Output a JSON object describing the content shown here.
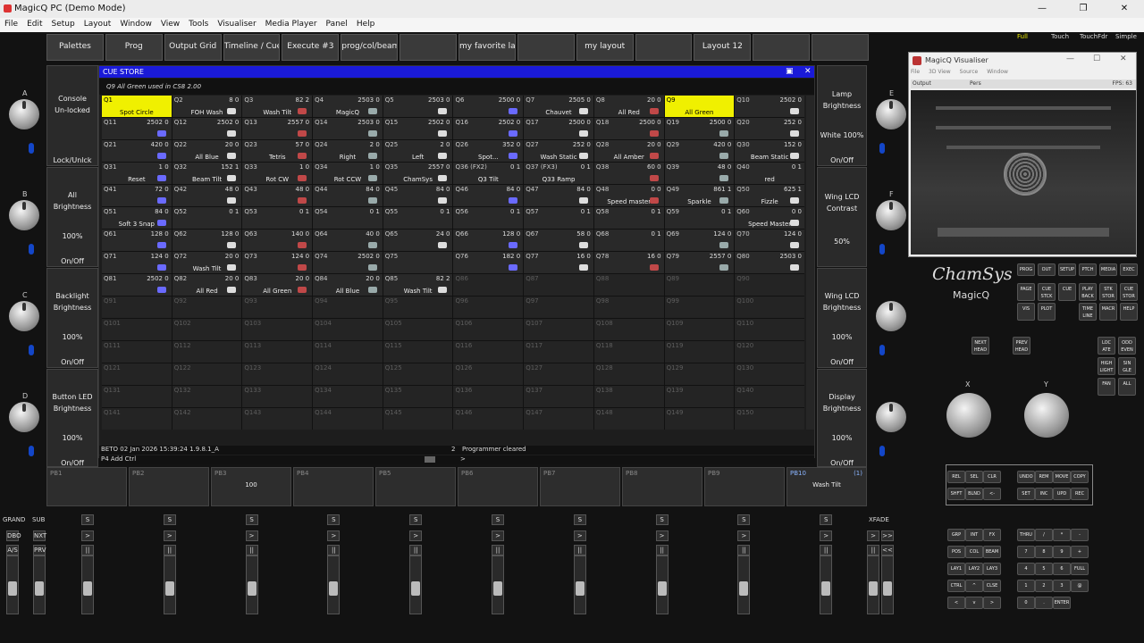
{
  "window": {
    "title": "MagicQ PC (Demo Mode)",
    "controls": [
      "—",
      "❐",
      "✕"
    ]
  },
  "menu": [
    "File",
    "Edit",
    "Setup",
    "Layout",
    "Window",
    "View",
    "Tools",
    "Visualiser",
    "Media Player",
    "Panel",
    "Help"
  ],
  "top_buttons": [
    "Palettes",
    "Prog",
    "Output Grid",
    "Timeline / Cues",
    "Execute #3",
    "prog/col/beam",
    "",
    "my favorite la",
    "",
    "my layout",
    "",
    "Layout 12",
    "",
    ""
  ],
  "left_column": [
    {
      "line1": "Console",
      "line2": "Un-locked",
      "value": "",
      "bottom": "Lock/Unlck",
      "letter": "A"
    },
    {
      "line1": "All",
      "line2": "Brightness",
      "value": "100%",
      "bottom": "On/Off",
      "letter": "B"
    },
    {
      "line1": "Backlight",
      "line2": "Brightness",
      "value": "100%",
      "bottom": "On/Off",
      "letter": "C"
    },
    {
      "line1": "Button LED",
      "line2": "Brightness",
      "value": "100%",
      "bottom": "On/Off",
      "letter": "D"
    }
  ],
  "right_column": [
    {
      "line1": "Lamp",
      "line2": "Brightness",
      "value": "White 100%",
      "bottom": "On/Off",
      "letter": "E"
    },
    {
      "line1": "Wing LCD",
      "line2": "Contrast",
      "value": "50%",
      "bottom": "",
      "letter": "F"
    },
    {
      "line1": "Wing LCD",
      "line2": "Brightness",
      "value": "100%",
      "bottom": "On/Off",
      "letter": ""
    },
    {
      "line1": "Display",
      "line2": "Brightness",
      "value": "100%",
      "bottom": "On/Off",
      "letter": ""
    }
  ],
  "cue_store": {
    "title": "CUE STORE",
    "info": "Q9 All Green used in CS8 2.00",
    "selected_index": 8,
    "cells": [
      {
        "id": "Q1",
        "num": "",
        "name": "Spot Circle"
      },
      {
        "id": "Q2",
        "num": "8 0",
        "name": "FOH Wash"
      },
      {
        "id": "Q3",
        "num": "82 2",
        "name": "Wash Tilt"
      },
      {
        "id": "Q4",
        "num": "2503 0",
        "name": "MagicQ"
      },
      {
        "id": "Q5",
        "num": "2503 0",
        "name": ""
      },
      {
        "id": "Q6",
        "num": "2500 0",
        "name": ""
      },
      {
        "id": "Q7",
        "num": "2505 0",
        "name": "Chauvet"
      },
      {
        "id": "Q8",
        "num": "20 0",
        "name": "All Red"
      },
      {
        "id": "Q9",
        "num": "",
        "name": "All Green"
      },
      {
        "id": "Q10",
        "num": "2502 0",
        "name": ""
      },
      {
        "id": "Q11",
        "num": "2502 0",
        "name": ""
      },
      {
        "id": "Q12",
        "num": "2502 0",
        "name": ""
      },
      {
        "id": "Q13",
        "num": "2557 0",
        "name": ""
      },
      {
        "id": "Q14",
        "num": "2503 0",
        "name": ""
      },
      {
        "id": "Q15",
        "num": "2502 0",
        "name": ""
      },
      {
        "id": "Q16",
        "num": "2502 0",
        "name": ""
      },
      {
        "id": "Q17",
        "num": "2500 0",
        "name": ""
      },
      {
        "id": "Q18",
        "num": "2500 0",
        "name": ""
      },
      {
        "id": "Q19",
        "num": "2500 0",
        "name": ""
      },
      {
        "id": "Q20",
        "num": "252 0",
        "name": ""
      },
      {
        "id": "Q21",
        "num": "420 0",
        "name": ""
      },
      {
        "id": "Q22",
        "num": "20 0",
        "name": "All Blue"
      },
      {
        "id": "Q23",
        "num": "57 0",
        "name": "Tetris"
      },
      {
        "id": "Q24",
        "num": "2 0",
        "name": "Right"
      },
      {
        "id": "Q25",
        "num": "2 0",
        "name": "Left"
      },
      {
        "id": "Q26",
        "num": "352 0",
        "name": "Spot..."
      },
      {
        "id": "Q27",
        "num": "252 0",
        "name": "Wash Static"
      },
      {
        "id": "Q28",
        "num": "20 0",
        "name": "All Amber"
      },
      {
        "id": "Q29",
        "num": "420 0",
        "name": ""
      },
      {
        "id": "Q30",
        "num": "152 0",
        "name": "Beam Static"
      },
      {
        "id": "Q31",
        "num": "1 0",
        "name": "Reset"
      },
      {
        "id": "Q32",
        "num": "152 1",
        "name": "Beam Tilt"
      },
      {
        "id": "Q33",
        "num": "1 0",
        "name": "Rot CW"
      },
      {
        "id": "Q34",
        "num": "1 0",
        "name": "Rot CCW"
      },
      {
        "id": "Q35",
        "num": "2557 0",
        "name": "ChamSys"
      },
      {
        "id": "Q36 (FX2)",
        "num": "0 1",
        "name": "Q3 Tilt"
      },
      {
        "id": "Q37 (FX3)",
        "num": "0 1",
        "name": "Q33 Ramp"
      },
      {
        "id": "Q38",
        "num": "60 0",
        "name": ""
      },
      {
        "id": "Q39",
        "num": "48 0",
        "name": ""
      },
      {
        "id": "Q40",
        "num": "0 1",
        "name": "red"
      },
      {
        "id": "Q41",
        "num": "72 0",
        "name": ""
      },
      {
        "id": "Q42",
        "num": "48 0",
        "name": ""
      },
      {
        "id": "Q43",
        "num": "48 0",
        "name": ""
      },
      {
        "id": "Q44",
        "num": "84 0",
        "name": ""
      },
      {
        "id": "Q45",
        "num": "84 0",
        "name": ""
      },
      {
        "id": "Q46",
        "num": "84 0",
        "name": ""
      },
      {
        "id": "Q47",
        "num": "84 0",
        "name": ""
      },
      {
        "id": "Q48",
        "num": "0 0",
        "name": "Speed master"
      },
      {
        "id": "Q49",
        "num": "861 1",
        "name": "Sparkle"
      },
      {
        "id": "Q50",
        "num": "625 1",
        "name": "Fizzle"
      },
      {
        "id": "Q51",
        "num": "84 0",
        "name": "Soft 3 Snap"
      },
      {
        "id": "Q52",
        "num": "0 1",
        "name": ""
      },
      {
        "id": "Q53",
        "num": "0 1",
        "name": ""
      },
      {
        "id": "Q54",
        "num": "0 1",
        "name": ""
      },
      {
        "id": "Q55",
        "num": "0 1",
        "name": ""
      },
      {
        "id": "Q56",
        "num": "0 1",
        "name": ""
      },
      {
        "id": "Q57",
        "num": "0 1",
        "name": ""
      },
      {
        "id": "Q58",
        "num": "0 1",
        "name": ""
      },
      {
        "id": "Q59",
        "num": "0 1",
        "name": ""
      },
      {
        "id": "Q60",
        "num": "0 0",
        "name": "Speed Master"
      },
      {
        "id": "Q61",
        "num": "128 0",
        "name": ""
      },
      {
        "id": "Q62",
        "num": "128 0",
        "name": ""
      },
      {
        "id": "Q63",
        "num": "140 0",
        "name": ""
      },
      {
        "id": "Q64",
        "num": "40 0",
        "name": ""
      },
      {
        "id": "Q65",
        "num": "24 0",
        "name": ""
      },
      {
        "id": "Q66",
        "num": "128 0",
        "name": ""
      },
      {
        "id": "Q67",
        "num": "58 0",
        "name": ""
      },
      {
        "id": "Q68",
        "num": "0 1",
        "name": ""
      },
      {
        "id": "Q69",
        "num": "124 0",
        "name": ""
      },
      {
        "id": "Q70",
        "num": "124 0",
        "name": ""
      },
      {
        "id": "Q71",
        "num": "124 0",
        "name": ""
      },
      {
        "id": "Q72",
        "num": "20 0",
        "name": "Wash Tilt"
      },
      {
        "id": "Q73",
        "num": "124 0",
        "name": ""
      },
      {
        "id": "Q74",
        "num": "2502 0",
        "name": ""
      },
      {
        "id": "Q75",
        "num": "",
        "name": ""
      },
      {
        "id": "Q76",
        "num": "182 0",
        "name": ""
      },
      {
        "id": "Q77",
        "num": "16 0",
        "name": ""
      },
      {
        "id": "Q78",
        "num": "16 0",
        "name": ""
      },
      {
        "id": "Q79",
        "num": "2557 0",
        "name": ""
      },
      {
        "id": "Q80",
        "num": "2503 0",
        "name": ""
      },
      {
        "id": "Q81",
        "num": "2502 0",
        "name": ""
      },
      {
        "id": "Q82",
        "num": "20 0",
        "name": "All Red"
      },
      {
        "id": "Q83",
        "num": "20 0",
        "name": "All Green"
      },
      {
        "id": "Q84",
        "num": "20 0",
        "name": "All Blue"
      },
      {
        "id": "Q85",
        "num": "82 2",
        "name": "Wash Tilt"
      },
      {
        "id": "Q86",
        "num": "",
        "name": ""
      },
      {
        "id": "Q87",
        "num": "",
        "name": ""
      },
      {
        "id": "Q88",
        "num": "",
        "name": ""
      },
      {
        "id": "Q89",
        "num": "",
        "name": ""
      },
      {
        "id": "Q90",
        "num": "",
        "name": ""
      },
      {
        "id": "Q91",
        "num": "",
        "name": ""
      },
      {
        "id": "Q92",
        "num": "",
        "name": ""
      },
      {
        "id": "Q93",
        "num": "",
        "name": ""
      },
      {
        "id": "Q94",
        "num": "",
        "name": ""
      },
      {
        "id": "Q95",
        "num": "",
        "name": ""
      },
      {
        "id": "Q96",
        "num": "",
        "name": ""
      },
      {
        "id": "Q97",
        "num": "",
        "name": ""
      },
      {
        "id": "Q98",
        "num": "",
        "name": ""
      },
      {
        "id": "Q99",
        "num": "",
        "name": ""
      },
      {
        "id": "Q100",
        "num": "",
        "name": ""
      },
      {
        "id": "Q101",
        "num": "",
        "name": ""
      },
      {
        "id": "Q102",
        "num": "",
        "name": ""
      },
      {
        "id": "Q103",
        "num": "",
        "name": ""
      },
      {
        "id": "Q104",
        "num": "",
        "name": ""
      },
      {
        "id": "Q105",
        "num": "",
        "name": ""
      },
      {
        "id": "Q106",
        "num": "",
        "name": ""
      },
      {
        "id": "Q107",
        "num": "",
        "name": ""
      },
      {
        "id": "Q108",
        "num": "",
        "name": ""
      },
      {
        "id": "Q109",
        "num": "",
        "name": ""
      },
      {
        "id": "Q110",
        "num": "",
        "name": ""
      },
      {
        "id": "Q111",
        "num": "",
        "name": ""
      },
      {
        "id": "Q112",
        "num": "",
        "name": ""
      },
      {
        "id": "Q113",
        "num": "",
        "name": ""
      },
      {
        "id": "Q114",
        "num": "",
        "name": ""
      },
      {
        "id": "Q115",
        "num": "",
        "name": ""
      },
      {
        "id": "Q116",
        "num": "",
        "name": ""
      },
      {
        "id": "Q117",
        "num": "",
        "name": ""
      },
      {
        "id": "Q118",
        "num": "",
        "name": ""
      },
      {
        "id": "Q119",
        "num": "",
        "name": ""
      },
      {
        "id": "Q120",
        "num": "",
        "name": ""
      },
      {
        "id": "Q121",
        "num": "",
        "name": ""
      },
      {
        "id": "Q122",
        "num": "",
        "name": ""
      },
      {
        "id": "Q123",
        "num": "",
        "name": ""
      },
      {
        "id": "Q124",
        "num": "",
        "name": ""
      },
      {
        "id": "Q125",
        "num": "",
        "name": ""
      },
      {
        "id": "Q126",
        "num": "",
        "name": ""
      },
      {
        "id": "Q127",
        "num": "",
        "name": ""
      },
      {
        "id": "Q128",
        "num": "",
        "name": ""
      },
      {
        "id": "Q129",
        "num": "",
        "name": ""
      },
      {
        "id": "Q130",
        "num": "",
        "name": ""
      },
      {
        "id": "Q131",
        "num": "",
        "name": ""
      },
      {
        "id": "Q132",
        "num": "",
        "name": ""
      },
      {
        "id": "Q133",
        "num": "",
        "name": ""
      },
      {
        "id": "Q134",
        "num": "",
        "name": ""
      },
      {
        "id": "Q135",
        "num": "",
        "name": ""
      },
      {
        "id": "Q136",
        "num": "",
        "name": ""
      },
      {
        "id": "Q137",
        "num": "",
        "name": ""
      },
      {
        "id": "Q138",
        "num": "",
        "name": ""
      },
      {
        "id": "Q139",
        "num": "",
        "name": ""
      },
      {
        "id": "Q140",
        "num": "",
        "name": ""
      },
      {
        "id": "Q141",
        "num": "",
        "name": ""
      },
      {
        "id": "Q142",
        "num": "",
        "name": ""
      },
      {
        "id": "Q143",
        "num": "",
        "name": ""
      },
      {
        "id": "Q144",
        "num": "",
        "name": ""
      },
      {
        "id": "Q145",
        "num": "",
        "name": ""
      },
      {
        "id": "Q146",
        "num": "",
        "name": ""
      },
      {
        "id": "Q147",
        "num": "",
        "name": ""
      },
      {
        "id": "Q148",
        "num": "",
        "name": ""
      },
      {
        "id": "Q149",
        "num": "",
        "name": ""
      },
      {
        "id": "Q150",
        "num": "",
        "name": ""
      }
    ]
  },
  "status": {
    "left": "BETO 02 Jan 2026 15:39:24 1.9.8.1_A",
    "count": "2",
    "message": "Programmer cleared",
    "cmd_left": "P4  Add Ctrl",
    "prompt": ">"
  },
  "playbacks": [
    {
      "label": "PB1",
      "value": ""
    },
    {
      "label": "PB2",
      "value": ""
    },
    {
      "label": "PB3",
      "value": "100"
    },
    {
      "label": "PB4",
      "value": ""
    },
    {
      "label": "PB5",
      "value": ""
    },
    {
      "label": "PB6",
      "value": ""
    },
    {
      "label": "PB7",
      "value": ""
    },
    {
      "label": "PB8",
      "value": ""
    },
    {
      "label": "PB9",
      "value": ""
    },
    {
      "label": "PB10",
      "value": "Wash Tilt",
      "num": "(1)"
    }
  ],
  "faders": {
    "grand_label": "GRAND",
    "sub_label": "SUB",
    "xfade_label": "XFADE",
    "grand_buttons": [
      "DBO",
      "A/S"
    ],
    "sub_buttons": [
      "NXT",
      "PRV"
    ],
    "pb_buttons": [
      "S",
      ">",
      "||"
    ],
    "xfade_buttons": [
      ">",
      ">>",
      "||",
      "<<"
    ]
  },
  "visualiser": {
    "title": "MagicQ Visualiser",
    "menu": [
      "File",
      "3D View",
      "Source",
      "Window"
    ],
    "toolbar_left": "Output",
    "toolbar_mid": "Pers",
    "fps": "FPS: 63"
  },
  "brand": {
    "name": "ChamSys",
    "product": "MagicQ"
  },
  "modes": [
    "Full",
    "Touch",
    "TouchFdr",
    "Simple"
  ],
  "keys": {
    "top": [
      [
        "PROG",
        "OUT",
        "SETUP",
        "PTCH",
        "MEDIA",
        "EXEC"
      ],
      [
        "PAGE",
        "CUE STCK",
        "CUE",
        "PLAY BACK",
        "STK STOR",
        "CUE STOR"
      ],
      [
        "VIS",
        "PLOT",
        "",
        "TIME LINE",
        "MACR",
        "HELP"
      ]
    ],
    "nextprev": [
      "NEXT HEAD",
      "PREV HEAD"
    ],
    "side": [
      "LOC ATE",
      "ODD EVEN",
      "HIGH LIGHT",
      "SIN GLE",
      "FAN",
      "ALL"
    ],
    "xy": [
      "X",
      "Y"
    ],
    "edit": [
      [
        "REL",
        "SEL",
        "CLR",
        "UNDO",
        "REM",
        "MOVE",
        "COPY"
      ],
      [
        "SHFT",
        "BLND",
        "<-",
        "SET",
        "INC",
        "UPD",
        "REC"
      ]
    ],
    "keypad": [
      [
        "GRP",
        "INT",
        "FX",
        "THRU",
        "/",
        "*",
        "-"
      ],
      [
        "POS",
        "COL",
        "BEAM",
        "7",
        "8",
        "9",
        "+"
      ],
      [
        "LAY1",
        "LAY2",
        "LAY3",
        "4",
        "5",
        "6",
        "FULL"
      ],
      [
        "CTRL",
        "^",
        "CLSE",
        "1",
        "2",
        "3",
        "@"
      ],
      [
        "<",
        "v",
        ">",
        "0",
        ".",
        "ENTER",
        ""
      ]
    ]
  }
}
